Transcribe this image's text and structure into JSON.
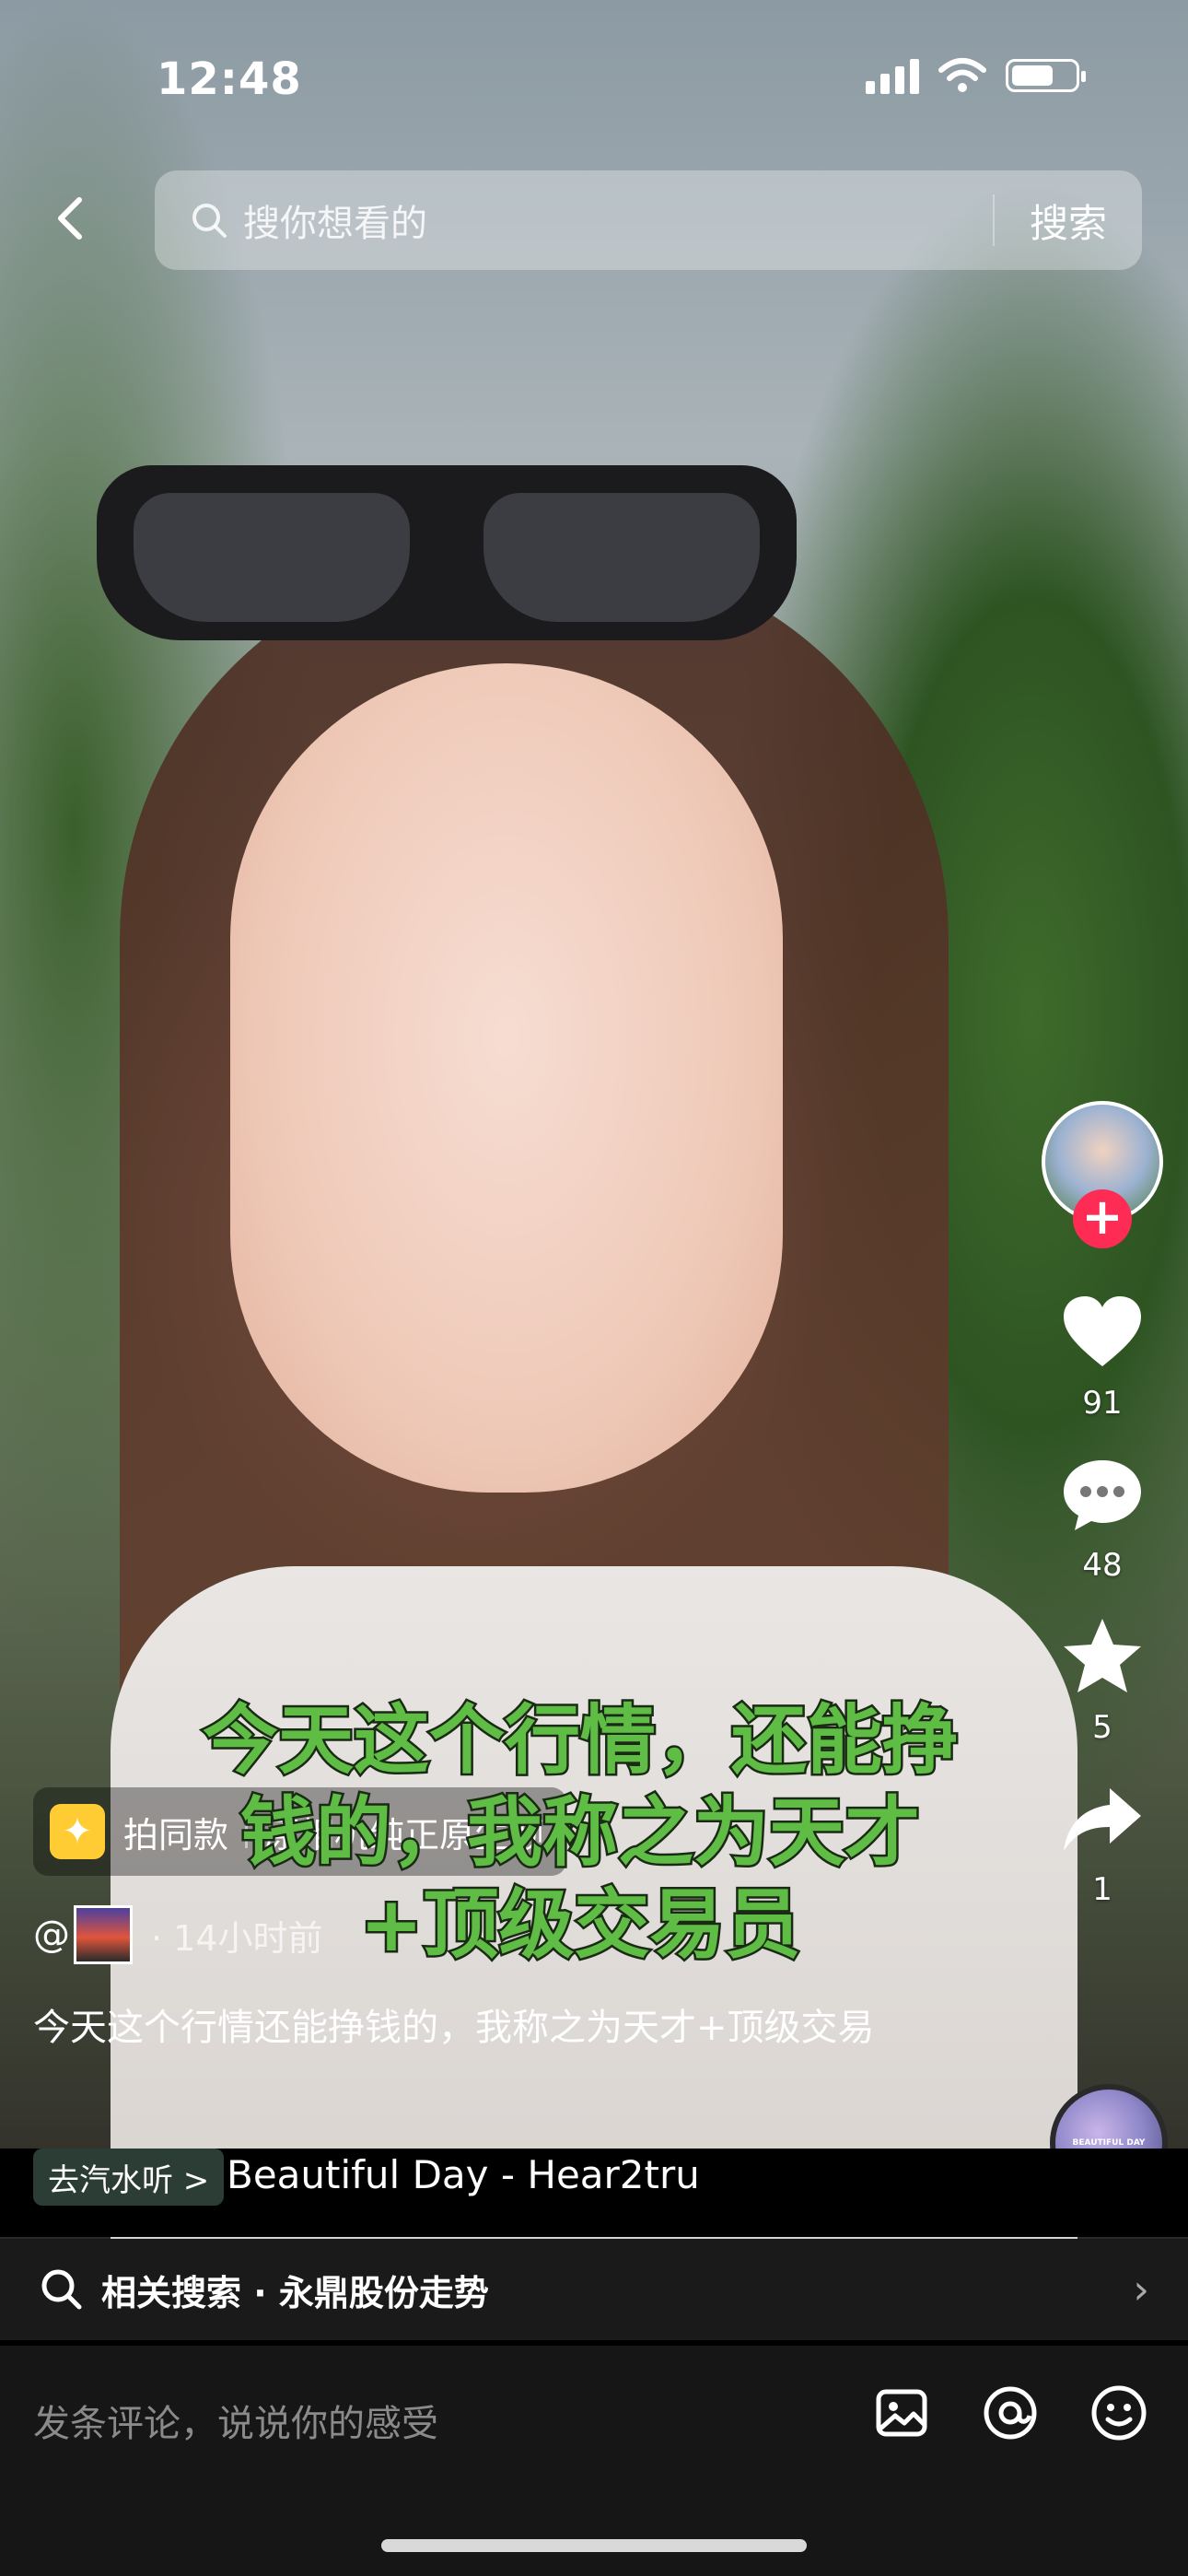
{
  "status_bar": {
    "time": "12:48"
  },
  "search": {
    "placeholder": "搜你想看的",
    "button": "搜索"
  },
  "caption_overlay": {
    "line1": "今天这个行情，还能挣",
    "line2": "钱的，我称之为天才",
    "line3": "+顶级交易员"
  },
  "effect_tag": {
    "label": "拍同款",
    "name": "原相机纯正原生颜"
  },
  "post": {
    "at_symbol": "@",
    "time_ago": "· 14小时前",
    "description": "今天这个行情还能挣钱的，我称之为天才+顶级交易"
  },
  "actions": {
    "likes": "91",
    "comments": "48",
    "favorites": "5",
    "shares": "1"
  },
  "music": {
    "chip_label": "去汽水听 >",
    "song_title": "Beautiful Day - Hear2tru",
    "disc_label": "BEAUTIFUL DAY"
  },
  "related_search": {
    "text": "相关搜索 · 永鼎股份走势"
  },
  "comment_bar": {
    "placeholder": "发条评论，说说你的感受"
  },
  "colors": {
    "like_red": "#fe2c55",
    "caption_green": "#5fbc45",
    "effect_yellow": "#ffcc33"
  }
}
